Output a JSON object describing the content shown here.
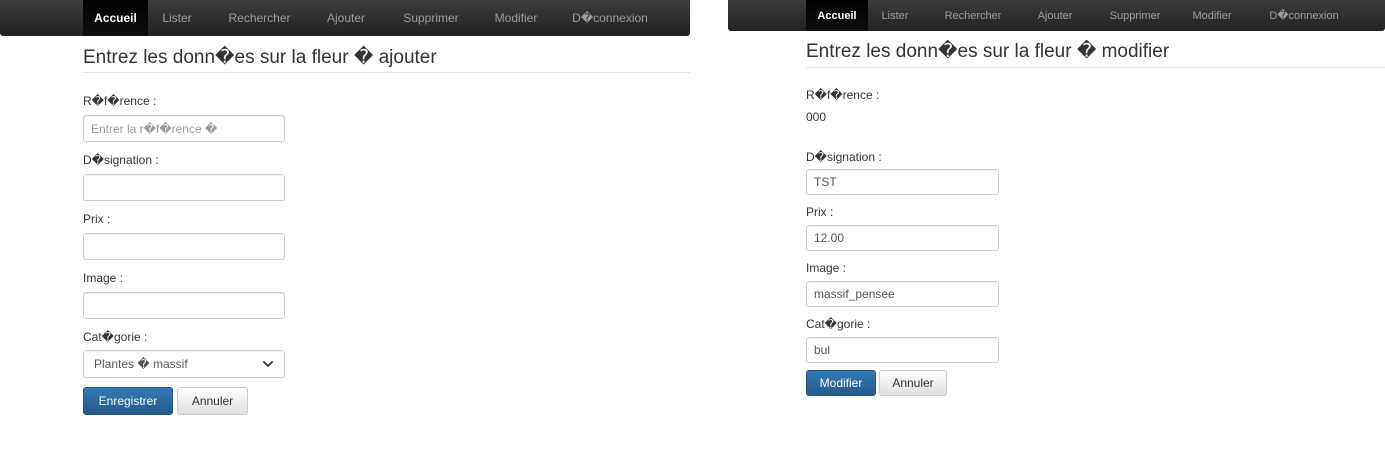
{
  "nav": {
    "items": [
      "Accueil",
      "Lister",
      "Rechercher",
      "Ajouter",
      "Supprimer",
      "Modifier",
      "D�connexion"
    ],
    "active": "Accueil"
  },
  "add_form": {
    "title": "Entrez les donn�es sur la fleur � ajouter",
    "reference_label": "R�f�rence :",
    "reference_placeholder": "Entrer la r�f�rence �",
    "designation_label": "D�signation :",
    "designation_value": "",
    "prix_label": "Prix :",
    "prix_value": "",
    "image_label": "Image :",
    "image_value": "",
    "categorie_label": "Cat�gorie :",
    "categorie_selected": "Plantes � massif",
    "save_label": "Enregistrer",
    "cancel_label": "Annuler"
  },
  "edit_form": {
    "title": "Entrez les donn�es sur la fleur � modifier",
    "reference_label": "R�f�rence :",
    "reference_value": "000",
    "designation_label": "D�signation :",
    "designation_value": "TST",
    "prix_label": "Prix :",
    "prix_value": "12.00",
    "image_label": "Image :",
    "image_value": "massif_pensee",
    "categorie_label": "Cat�gorie :",
    "categorie_value": "bul",
    "modify_label": "Modifier",
    "cancel_label": "Annuler"
  }
}
